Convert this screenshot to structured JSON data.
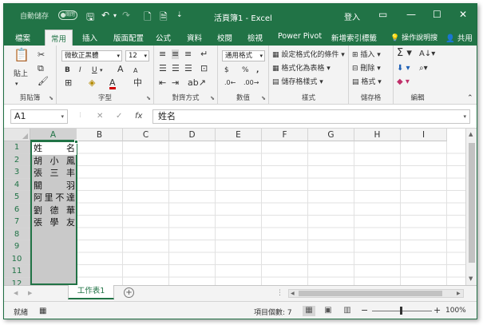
{
  "titlebar": {
    "autosave_label": "自動儲存",
    "autosave_state": "關閉",
    "doc_title": "活頁簿1 - Excel",
    "login": "登入"
  },
  "ribbon_tabs": [
    "檔案",
    "常用",
    "插入",
    "版面配置",
    "公式",
    "資料",
    "校閱",
    "檢視",
    "Power Pivot",
    "新增索引標籤"
  ],
  "active_tab": "常用",
  "tell_me": "操作說明搜",
  "share": "共用",
  "clipboard": {
    "paste": "貼上",
    "label": "剪貼簿"
  },
  "font": {
    "name": "微軟正黑體",
    "size": "12",
    "bold": "B",
    "italic": "I",
    "underline": "U",
    "grow": "A",
    "shrink": "A",
    "label": "字型"
  },
  "alignment": {
    "label": "對齊方式"
  },
  "number": {
    "format": "通用格式",
    "currency": "$",
    "percent": "%",
    "comma": ",",
    "label": "數值"
  },
  "styles": {
    "conditional": "設定格式化的條件",
    "as_table": "格式化為表格",
    "cell_styles": "儲存格樣式",
    "label": "樣式"
  },
  "cells": {
    "insert": "插入",
    "delete": "刪除",
    "format": "格式",
    "label": "儲存格"
  },
  "editing": {
    "label": "編輯"
  },
  "formula_bar": {
    "name_box": "A1",
    "fx": "fx",
    "content": "姓名"
  },
  "columns": [
    "A",
    "B",
    "C",
    "D",
    "E",
    "F",
    "G",
    "H",
    "I"
  ],
  "rows": [
    "1",
    "2",
    "3",
    "4",
    "5",
    "6",
    "7",
    "8",
    "9",
    "10",
    "11",
    "12"
  ],
  "column_a_values": [
    "姓名",
    "胡小鳳",
    "張三丰",
    "關羽",
    "阿里不達",
    "劉德華",
    "張學友"
  ],
  "sheet_tab": "工作表1",
  "status": {
    "ready": "就緒",
    "count": "項目個數: 7",
    "zoom": "100%"
  }
}
